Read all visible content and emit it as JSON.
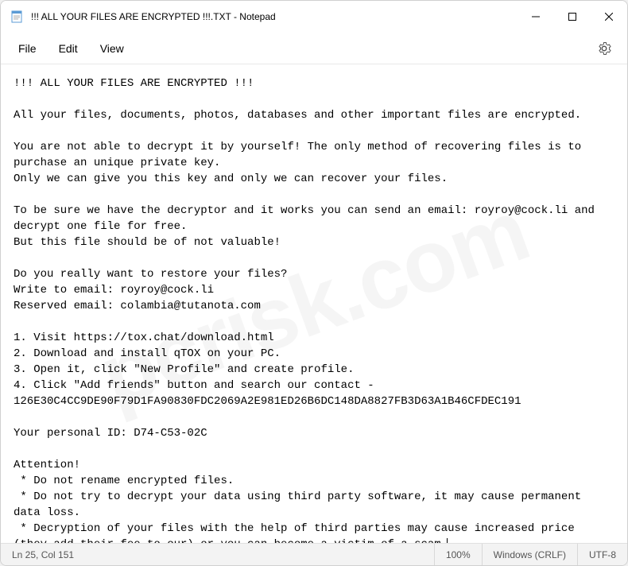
{
  "titlebar": {
    "title": "!!! ALL YOUR FILES ARE ENCRYPTED !!!.TXT - Notepad"
  },
  "menubar": {
    "file": "File",
    "edit": "Edit",
    "view": "View"
  },
  "content": {
    "text": "!!! ALL YOUR FILES ARE ENCRYPTED !!!\n\nAll your files, documents, photos, databases and other important files are encrypted.\n\nYou are not able to decrypt it by yourself! The only method of recovering files is to purchase an unique private key.\nOnly we can give you this key and only we can recover your files.\n\nTo be sure we have the decryptor and it works you can send an email: royroy@cock.li and decrypt one file for free.\nBut this file should be of not valuable!\n\nDo you really want to restore your files?\nWrite to email: royroy@cock.li\nReserved email: colambia@tutanota.com\n\n1. Visit https://tox.chat/download.html\n2. Download and install qTOX on your PC.\n3. Open it, click \"New Profile\" and create profile.\n4. Click \"Add friends\" button and search our contact - 126E30C4CC9DE90F79D1FA90830FDC2069A2E981ED26B6DC148DA8827FB3D63A1B46CFDEC191\n\nYour personal ID: D74-C53-02C\n\nAttention!\n * Do not rename encrypted files.\n * Do not try to decrypt your data using third party software, it may cause permanent data loss.\n * Decryption of your files with the help of third parties may cause increased price (they add their fee to our) or you can become a victim of a scam."
  },
  "statusbar": {
    "position": "Ln 25, Col 151",
    "zoom": "100%",
    "lineending": "Windows (CRLF)",
    "encoding": "UTF-8"
  },
  "watermark": "pcrisk.com"
}
